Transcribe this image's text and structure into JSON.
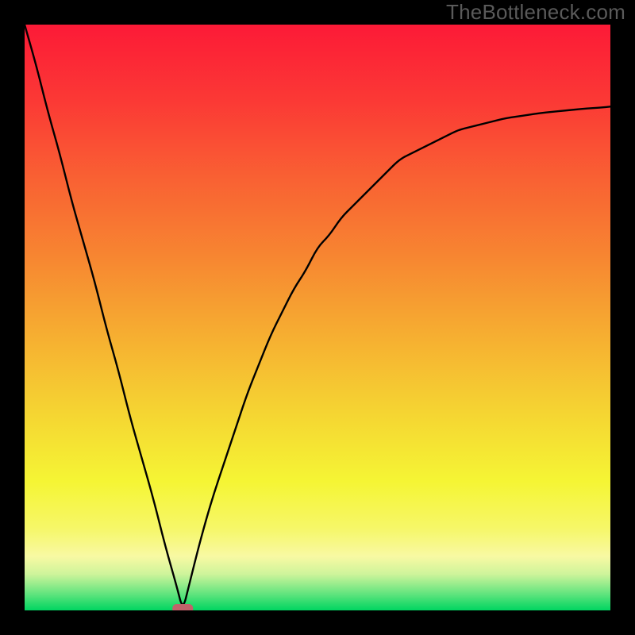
{
  "watermark": "TheBottleneck.com",
  "chart_data": {
    "type": "line",
    "title": "",
    "xlabel": "",
    "ylabel": "",
    "xlim": [
      0,
      100
    ],
    "ylim": [
      0,
      100
    ],
    "min_x": 27,
    "series": [
      {
        "name": "bottleneck-curve",
        "x": [
          0,
          2,
          4,
          6,
          8,
          10,
          12,
          14,
          16,
          18,
          20,
          22,
          24,
          26,
          27,
          28,
          30,
          32,
          34,
          36,
          38,
          40,
          42,
          44,
          46,
          48,
          50,
          52,
          54,
          56,
          58,
          60,
          62,
          64,
          66,
          68,
          70,
          72,
          74,
          76,
          78,
          80,
          82,
          84,
          86,
          88,
          90,
          92,
          94,
          96,
          98,
          100
        ],
        "values": [
          100,
          93,
          85,
          78,
          70,
          63,
          56,
          48,
          41,
          33,
          26,
          19,
          11,
          4,
          0,
          4,
          12,
          19,
          25,
          31,
          37,
          42,
          47,
          51,
          55,
          58,
          62,
          64,
          67,
          69,
          71,
          73,
          75,
          77,
          78,
          79,
          80,
          81,
          82,
          82.5,
          83,
          83.5,
          84,
          84.3,
          84.6,
          84.9,
          85.1,
          85.3,
          85.5,
          85.7,
          85.8,
          86
        ]
      }
    ],
    "marker": {
      "x": 27,
      "y": 0,
      "color": "#c1626a"
    },
    "background_gradient": {
      "stops": [
        {
          "offset": 0.0,
          "color": "#fc1a37"
        },
        {
          "offset": 0.13,
          "color": "#fb3935"
        },
        {
          "offset": 0.26,
          "color": "#f96033"
        },
        {
          "offset": 0.39,
          "color": "#f78431"
        },
        {
          "offset": 0.52,
          "color": "#f6ab31"
        },
        {
          "offset": 0.65,
          "color": "#f5d132"
        },
        {
          "offset": 0.78,
          "color": "#f5f534"
        },
        {
          "offset": 0.86,
          "color": "#f6f768"
        },
        {
          "offset": 0.908,
          "color": "#f8f9a3"
        },
        {
          "offset": 0.938,
          "color": "#cef49b"
        },
        {
          "offset": 0.958,
          "color": "#8feb8a"
        },
        {
          "offset": 0.974,
          "color": "#5ae37c"
        },
        {
          "offset": 0.987,
          "color": "#2cdc6e"
        },
        {
          "offset": 1.0,
          "color": "#01d561"
        }
      ]
    }
  }
}
